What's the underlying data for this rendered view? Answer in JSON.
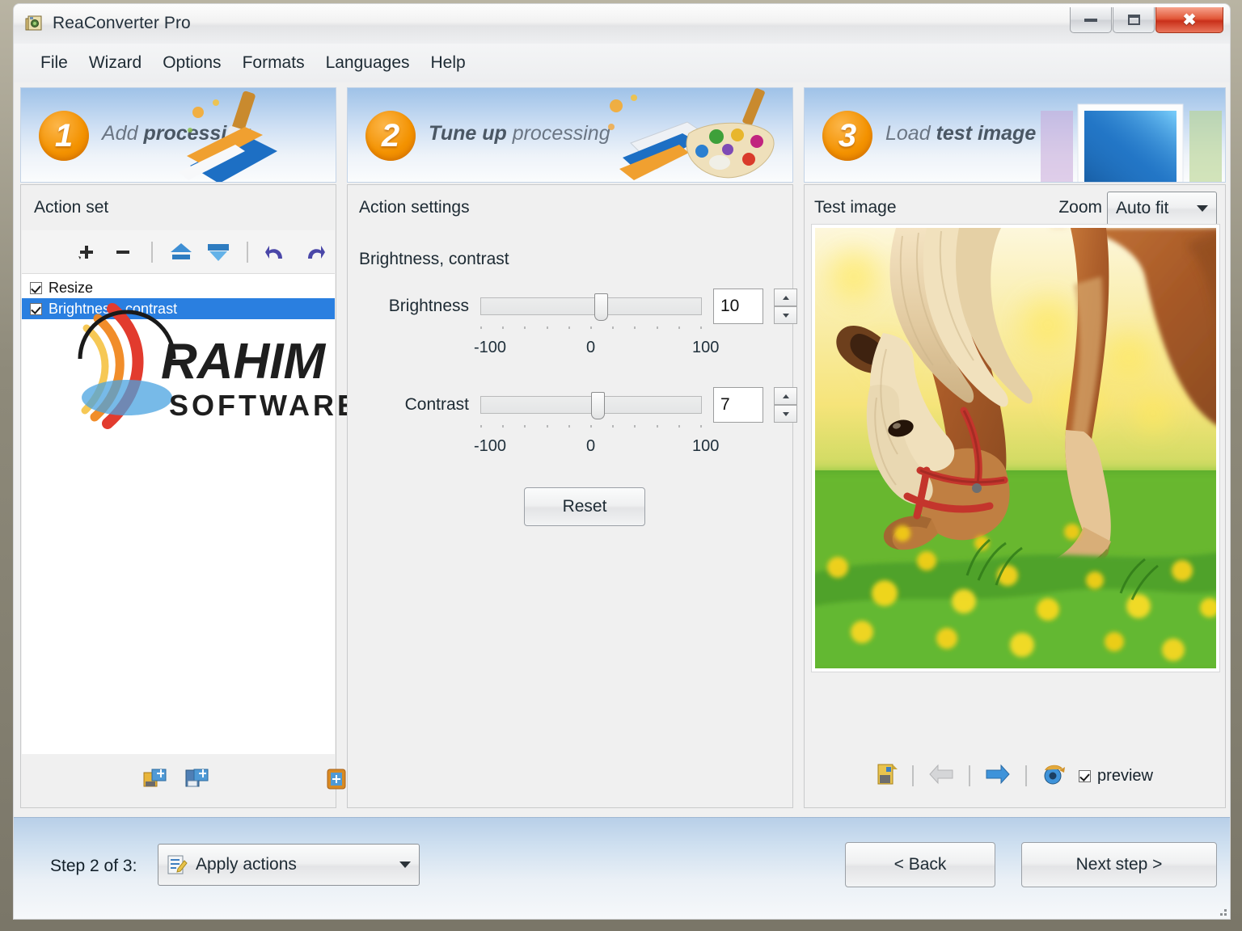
{
  "window": {
    "title": "ReaConverter Pro",
    "icon": "app-icon",
    "controls": {
      "minimize": "minimize",
      "maximize": "maximize",
      "close": "close"
    }
  },
  "menu": {
    "items": [
      "File",
      "Wizard",
      "Options",
      "Formats",
      "Languages",
      "Help"
    ]
  },
  "steps": [
    {
      "number": "1",
      "light": "Add ",
      "bold": "processing"
    },
    {
      "number": "2",
      "bold": "Tune up ",
      "light": "processing"
    },
    {
      "number": "3",
      "light": "Load ",
      "bold": "test image"
    }
  ],
  "action_set": {
    "heading": "Action set",
    "toolbar": [
      "add-action-icon",
      "remove-action-icon",
      "move-up-icon",
      "move-down-icon",
      "undo-icon",
      "redo-icon"
    ],
    "items": [
      {
        "label": "Resize",
        "checked": true,
        "selected": false
      },
      {
        "label": "Brightness, contrast",
        "checked": true,
        "selected": true
      }
    ],
    "footer_icons": [
      "open-action-set-icon",
      "save-action-set-icon",
      "action-info-icon"
    ]
  },
  "settings": {
    "heading": "Action settings",
    "subheading": "Brightness, contrast",
    "sliders": [
      {
        "label": "Brightness",
        "value": "10",
        "min_label": "-100",
        "mid_label": "0",
        "max_label": "100",
        "min": -100,
        "max": 100
      },
      {
        "label": "Contrast",
        "value": "7",
        "min_label": "-100",
        "mid_label": "0",
        "max_label": "100",
        "min": -100,
        "max": 100
      }
    ],
    "reset_label": "Reset"
  },
  "preview": {
    "heading": "Test image",
    "zoom_label": "Zoom",
    "zoom_value": "Auto fit",
    "toolbar": [
      "open-image-icon",
      "previous-image-icon",
      "next-image-icon",
      "refresh-preview-icon"
    ],
    "preview_checkbox_label": "preview",
    "preview_checked": true,
    "image_alt": "Horse grazing in a field of yellow dandelions"
  },
  "footer": {
    "step_text": "Step 2 of 3:",
    "mode_value": "Apply actions",
    "mode_icon": "apply-actions-icon",
    "back_label": "< Back",
    "next_label": "Next step >"
  },
  "watermark": {
    "line1": "RAHIM",
    "line2": "SOFTWARE"
  },
  "colors": {
    "accent_orange": "#f39200",
    "selection_blue": "#2a7fe0",
    "close_red": "#c9301a",
    "banner_blue": "#9fc2e8"
  }
}
